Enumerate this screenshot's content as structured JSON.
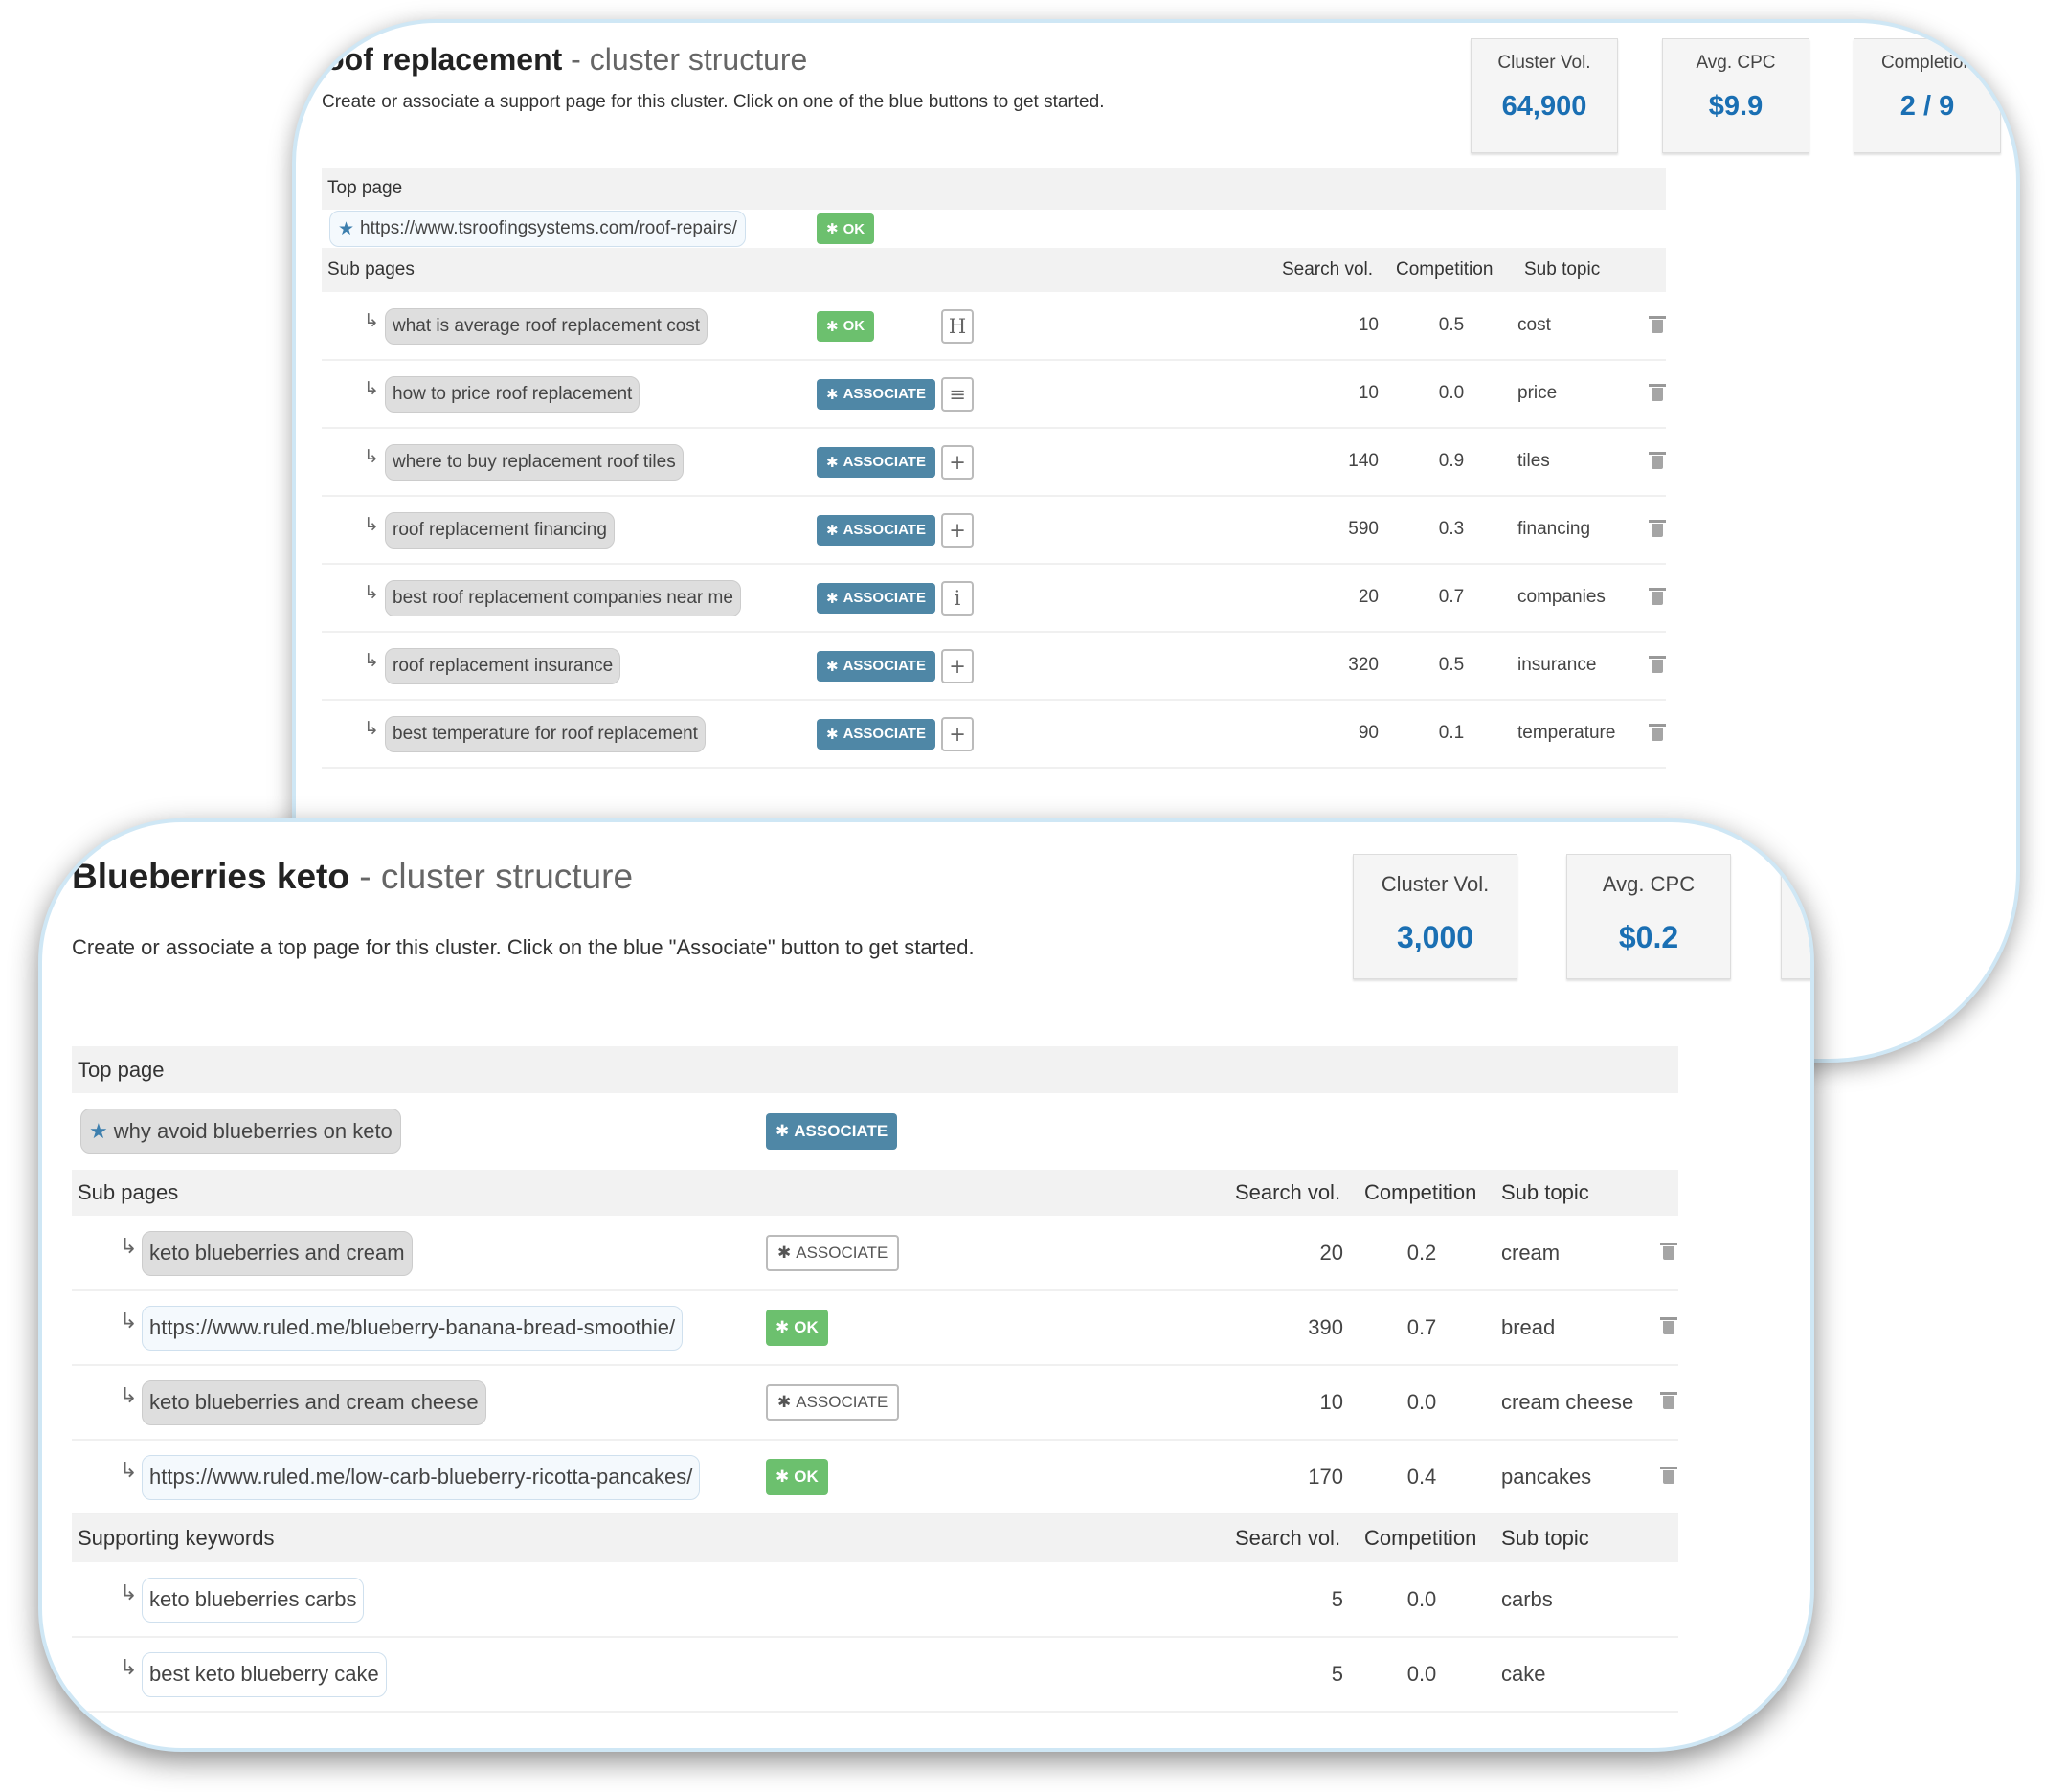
{
  "colors": {
    "accent_blue": "#1a6fb3",
    "associate": "#4f87a6",
    "ok_green": "#6cc06e",
    "card_border": "#cfe7f5"
  },
  "roof": {
    "title_main": "Roof replacement",
    "title_sep": " - ",
    "title_sub": "cluster structure",
    "description": "Create or associate a support page for this cluster. Click on one of the blue buttons to get started.",
    "stats": [
      {
        "label": "Cluster Vol.",
        "value": "64,900"
      },
      {
        "label": "Avg. CPC",
        "value": "$9.9"
      },
      {
        "label": "Completion",
        "value": "2 / 9"
      }
    ],
    "top_page_header": "Top page",
    "top_page": {
      "text": "https://www.tsroofingsystems.com/roof-repairs/",
      "kind": "url",
      "icon": "star-icon",
      "button": "OK",
      "button_kind": "ok"
    },
    "sub_pages_header": "Sub pages",
    "columns": [
      "Search vol.",
      "Competition",
      "Sub topic"
    ],
    "sub_pages": [
      {
        "text": "what is average roof replacement cost",
        "kind": "kw",
        "button": "OK",
        "button_kind": "ok",
        "extra": "H",
        "extra_icon": "heading-icon",
        "vol": "10",
        "comp": "0.5",
        "topic": "cost"
      },
      {
        "text": "how to price roof replacement",
        "kind": "kw",
        "button": "ASSOCIATE",
        "button_kind": "assoc",
        "extra": "≡",
        "extra_icon": "align-left-icon",
        "vol": "10",
        "comp": "0.0",
        "topic": "price"
      },
      {
        "text": "where to buy replacement roof tiles",
        "kind": "kw",
        "button": "ASSOCIATE",
        "button_kind": "assoc",
        "extra": "+",
        "extra_icon": "plus-icon",
        "vol": "140",
        "comp": "0.9",
        "topic": "tiles"
      },
      {
        "text": "roof replacement financing",
        "kind": "kw",
        "button": "ASSOCIATE",
        "button_kind": "assoc",
        "extra": "+",
        "extra_icon": "plus-icon",
        "vol": "590",
        "comp": "0.3",
        "topic": "financing"
      },
      {
        "text": "best roof replacement companies near me",
        "kind": "kw",
        "button": "ASSOCIATE",
        "button_kind": "assoc",
        "extra": "i",
        "extra_icon": "info-icon",
        "vol": "20",
        "comp": "0.7",
        "topic": "companies"
      },
      {
        "text": "roof replacement insurance",
        "kind": "kw",
        "button": "ASSOCIATE",
        "button_kind": "assoc",
        "extra": "+",
        "extra_icon": "plus-icon",
        "vol": "320",
        "comp": "0.5",
        "topic": "insurance"
      },
      {
        "text": "best temperature for roof replacement",
        "kind": "kw",
        "button": "ASSOCIATE",
        "button_kind": "assoc",
        "extra": "+",
        "extra_icon": "plus-icon",
        "vol": "90",
        "comp": "0.1",
        "topic": "temperature"
      }
    ]
  },
  "keto": {
    "title_main": "Blueberries keto",
    "title_sep": " - ",
    "title_sub": "cluster structure",
    "description": "Create or associate a top page for this cluster. Click on the blue \"Associate\" button to get started.",
    "stats": [
      {
        "label": "Cluster Vol.",
        "value": "3,000"
      },
      {
        "label": "Avg. CPC",
        "value": "$0.2"
      }
    ],
    "top_page_header": "Top page",
    "top_page": {
      "text": "why avoid blueberries on keto",
      "kind": "kw",
      "icon": "star-icon",
      "button": "ASSOCIATE",
      "button_kind": "assoc"
    },
    "sub_pages_header": "Sub pages",
    "columns": [
      "Search vol.",
      "Competition",
      "Sub topic"
    ],
    "sub_pages": [
      {
        "text": "keto blueberries and cream",
        "kind": "kw",
        "button": "ASSOCIATE",
        "button_kind": "assoc-outline",
        "vol": "20",
        "comp": "0.2",
        "topic": "cream"
      },
      {
        "text": "https://www.ruled.me/blueberry-banana-bread-smoothie/",
        "kind": "url",
        "button": "OK",
        "button_kind": "ok",
        "vol": "390",
        "comp": "0.7",
        "topic": "bread"
      },
      {
        "text": "keto blueberries and cream cheese",
        "kind": "kw",
        "button": "ASSOCIATE",
        "button_kind": "assoc-outline",
        "vol": "10",
        "comp": "0.0",
        "topic": "cream cheese"
      },
      {
        "text": "https://www.ruled.me/low-carb-blueberry-ricotta-pancakes/",
        "kind": "url",
        "button": "OK",
        "button_kind": "ok",
        "vol": "170",
        "comp": "0.4",
        "topic": "pancakes"
      }
    ],
    "supporting_header": "Supporting keywords",
    "supporting": [
      {
        "text": "keto blueberries carbs",
        "kind": "sup",
        "vol": "5",
        "comp": "0.0",
        "topic": "carbs"
      },
      {
        "text": "best keto blueberry cake",
        "kind": "sup",
        "vol": "5",
        "comp": "0.0",
        "topic": "cake"
      }
    ]
  }
}
